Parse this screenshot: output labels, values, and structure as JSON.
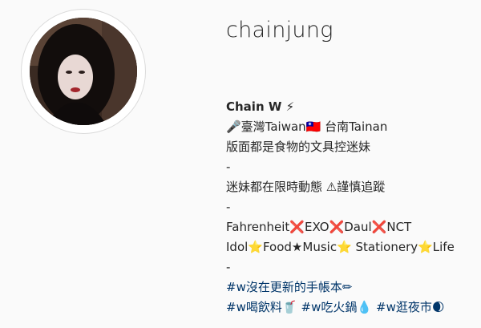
{
  "profile": {
    "username": "chainjung",
    "display_name": "Chain W ⚡"
  },
  "bio": {
    "line1": "🎤臺灣Taiwan🇹🇼 台南Tainan",
    "line2": "版面都是食物的文具控迷妹",
    "line3": "-",
    "line4": "迷妹都在限時動態 ⚠謹慎追蹤",
    "line5": "-",
    "line6": "Fahrenheit❌EXO❌Daul❌NCT",
    "line7": "Idol⭐Food★Music⭐ Stationery⭐Life",
    "line8": "-",
    "hashtags": {
      "h1": "#w沒在更新的手帳本✏",
      "h2": "#w喝飲料🥤",
      "h3": "#w吃火鍋💧",
      "h4": "#w逛夜市🌒"
    }
  },
  "colors": {
    "background": "#fafafa",
    "text": "#262626",
    "hashtag": "#003569"
  }
}
